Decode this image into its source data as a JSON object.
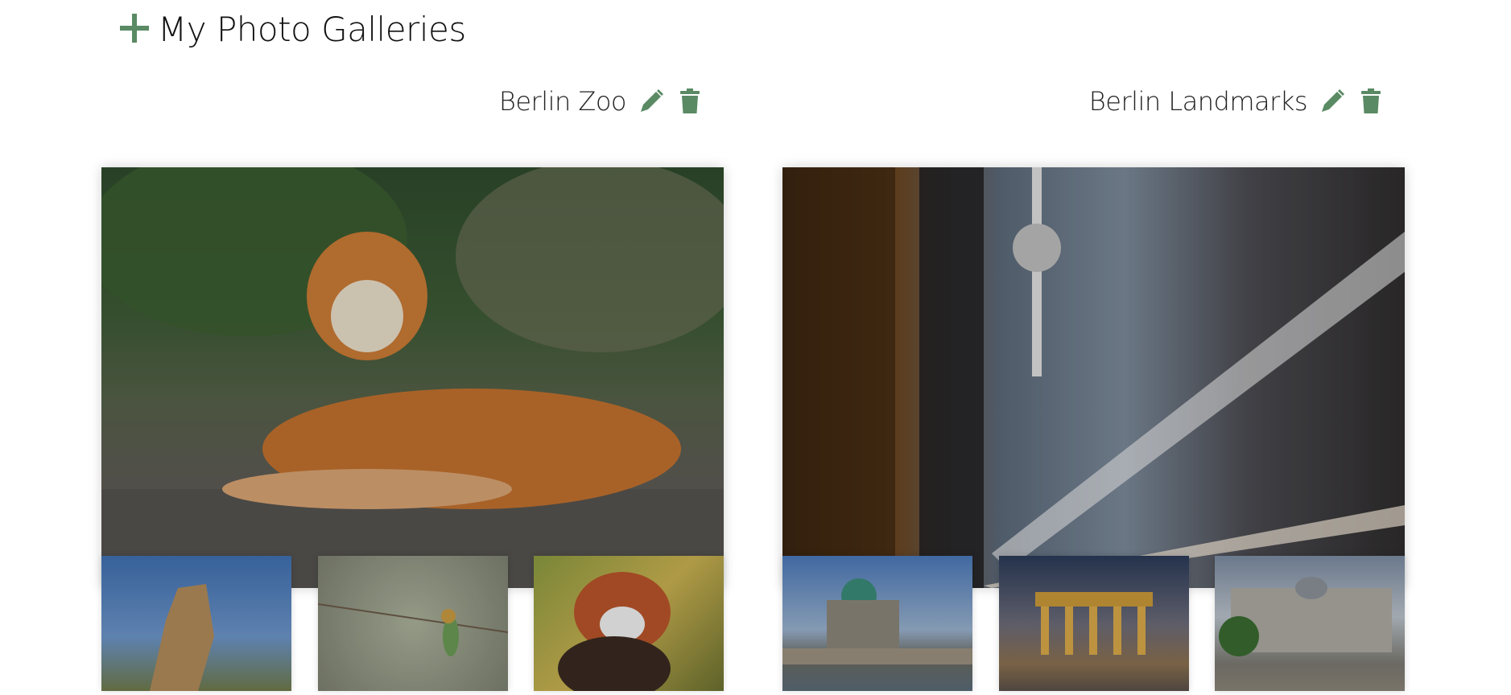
{
  "header": {
    "title": "My Photo Galleries",
    "add_icon": "plus-icon",
    "accent_color": "#5a8a64"
  },
  "galleries": [
    {
      "name": "Berlin Zoo",
      "edit_icon": "pencil-icon",
      "delete_icon": "trash-icon",
      "cover": "tiger",
      "thumbnails": [
        "giraffe",
        "bee-eater bird",
        "red panda"
      ]
    },
    {
      "name": "Berlin Landmarks",
      "edit_icon": "pencil-icon",
      "delete_icon": "trash-icon",
      "cover": "TV tower street at night",
      "thumbnails": [
        "Berlin Cathedral",
        "Brandenburg Gate",
        "Reichstag"
      ]
    }
  ]
}
